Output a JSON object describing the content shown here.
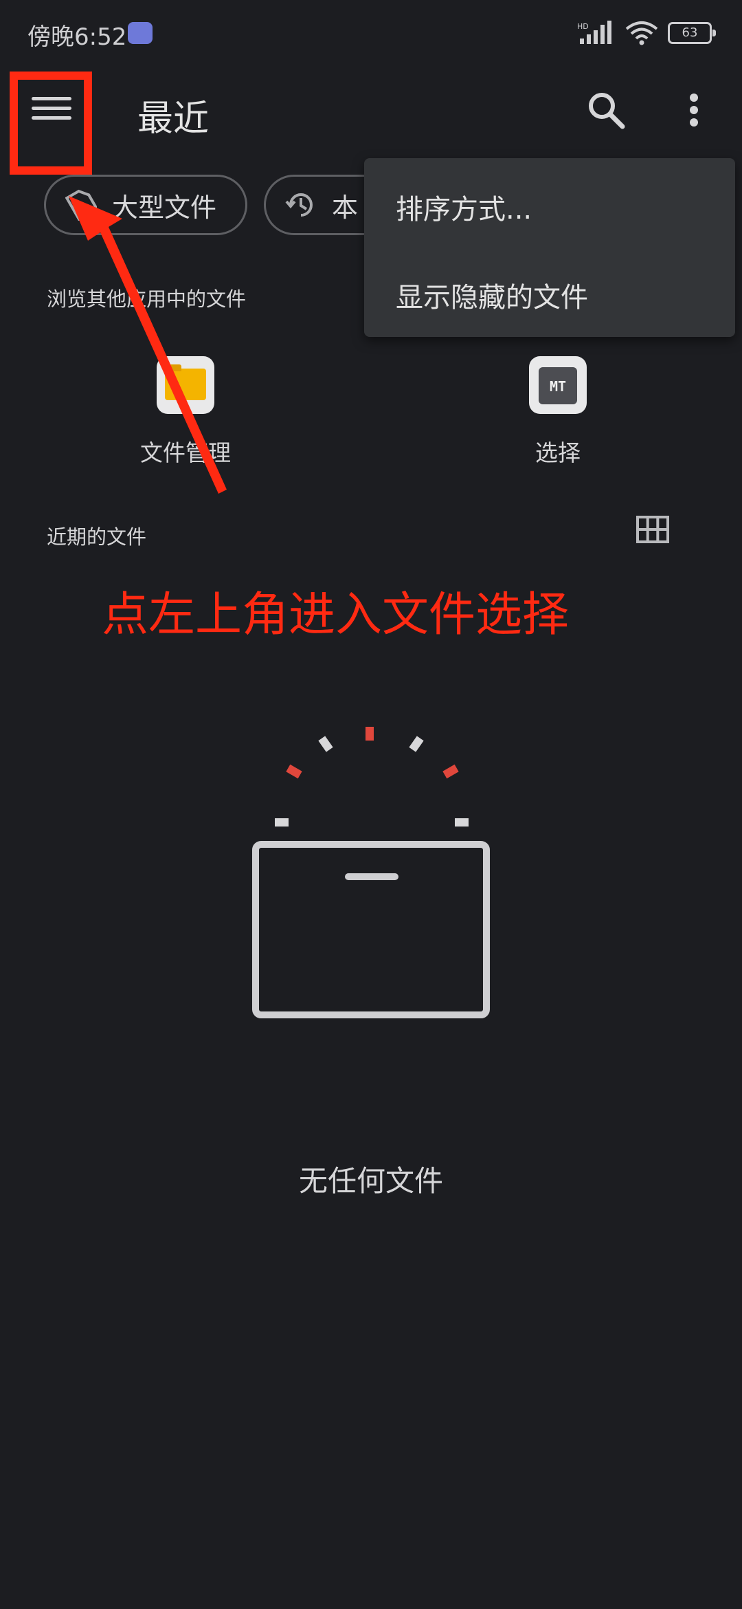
{
  "status_bar": {
    "time": "傍晚6:52",
    "battery": "63",
    "icons": [
      "hd-signal-icon",
      "wifi-icon",
      "battery-icon"
    ]
  },
  "app_bar": {
    "title": "最近",
    "icons": [
      "menu-icon",
      "search-icon",
      "more-vert-icon"
    ]
  },
  "chips": [
    {
      "label": "大型文件",
      "icon": "large-file-icon"
    },
    {
      "label": "本",
      "icon": "history-icon"
    }
  ],
  "browse_section": {
    "label": "浏览其他应用中的文件",
    "apps": [
      {
        "label": "文件管理",
        "icon": "folder-icon"
      },
      {
        "label": "选择",
        "icon": "mt-manager-icon"
      }
    ]
  },
  "recent_section": {
    "label": "近期的文件",
    "view_toggle_icon": "grid-view-icon"
  },
  "overflow_menu": {
    "items": [
      "排序方式...",
      "显示隐藏的文件"
    ]
  },
  "annotation": {
    "text": "点左上角进入文件选择",
    "color": "#ff2a12"
  },
  "empty_state": {
    "illustration": "empty-box-icon",
    "message": "无任何文件"
  },
  "colors": {
    "background": "#1c1d21",
    "menu_background": "#333538",
    "accent_red": "#ff2a12"
  }
}
